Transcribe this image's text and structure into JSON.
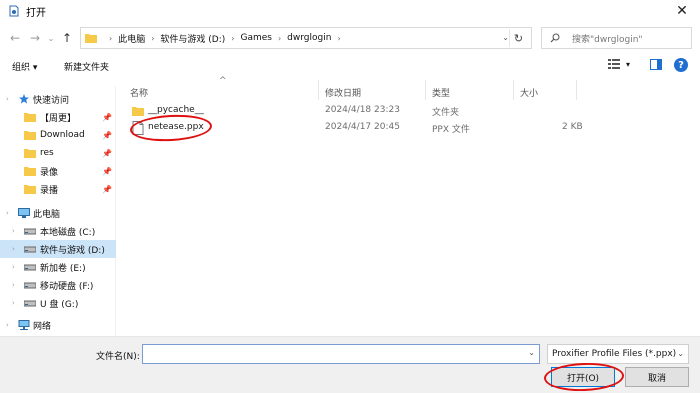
{
  "window": {
    "title": "打开"
  },
  "nav": {
    "breadcrumbs": [
      "此电脑",
      "软件与游戏 (D:)",
      "Games",
      "dwrglogin"
    ]
  },
  "search": {
    "placeholder": "搜索\"dwrglogin\""
  },
  "toolbar": {
    "organize": "组织",
    "new_folder": "新建文件夹"
  },
  "sidebar": {
    "items": [
      {
        "label": "快速访问",
        "icon": "star-icon",
        "pinned": false
      },
      {
        "label": "【周更】",
        "icon": "folder-icon",
        "pinned": true
      },
      {
        "label": "Download",
        "icon": "folder-icon",
        "pinned": true
      },
      {
        "label": "res",
        "icon": "folder-icon",
        "pinned": true
      },
      {
        "label": "录像",
        "icon": "folder-icon",
        "pinned": true
      },
      {
        "label": "录播",
        "icon": "folder-icon",
        "pinned": true
      },
      {
        "label": "此电脑",
        "icon": "computer-icon",
        "pinned": false
      },
      {
        "label": "本地磁盘 (C:)",
        "icon": "drive-icon",
        "pinned": false
      },
      {
        "label": "软件与游戏 (D:)",
        "icon": "drive-icon",
        "pinned": false
      },
      {
        "label": "新加卷 (E:)",
        "icon": "drive-icon",
        "pinned": false
      },
      {
        "label": "移动硬盘 (F:)",
        "icon": "drive-icon",
        "pinned": false
      },
      {
        "label": "U 盘 (G:)",
        "icon": "drive-icon",
        "pinned": false
      },
      {
        "label": "网络",
        "icon": "network-icon",
        "pinned": false
      }
    ]
  },
  "files": {
    "columns": [
      "名称",
      "修改日期",
      "类型",
      "大小"
    ],
    "rows": [
      {
        "name": "__pycache__",
        "date": "2024/4/18 23:23",
        "type": "文件夹",
        "size": ""
      },
      {
        "name": "netease.ppx",
        "date": "2024/4/17 20:45",
        "type": "PPX 文件",
        "size": "2 KB"
      }
    ]
  },
  "bottom": {
    "filename_label": "文件名(N):",
    "filename_value": "",
    "file_type": "Proxifier Profile Files (*.ppx)",
    "open_label": "打开(O)",
    "cancel_label": "取消"
  },
  "colors": {
    "accent": "#0078d7",
    "selection": "#cce4f7",
    "annotation": "#e01010",
    "folder": "#f7c948"
  }
}
